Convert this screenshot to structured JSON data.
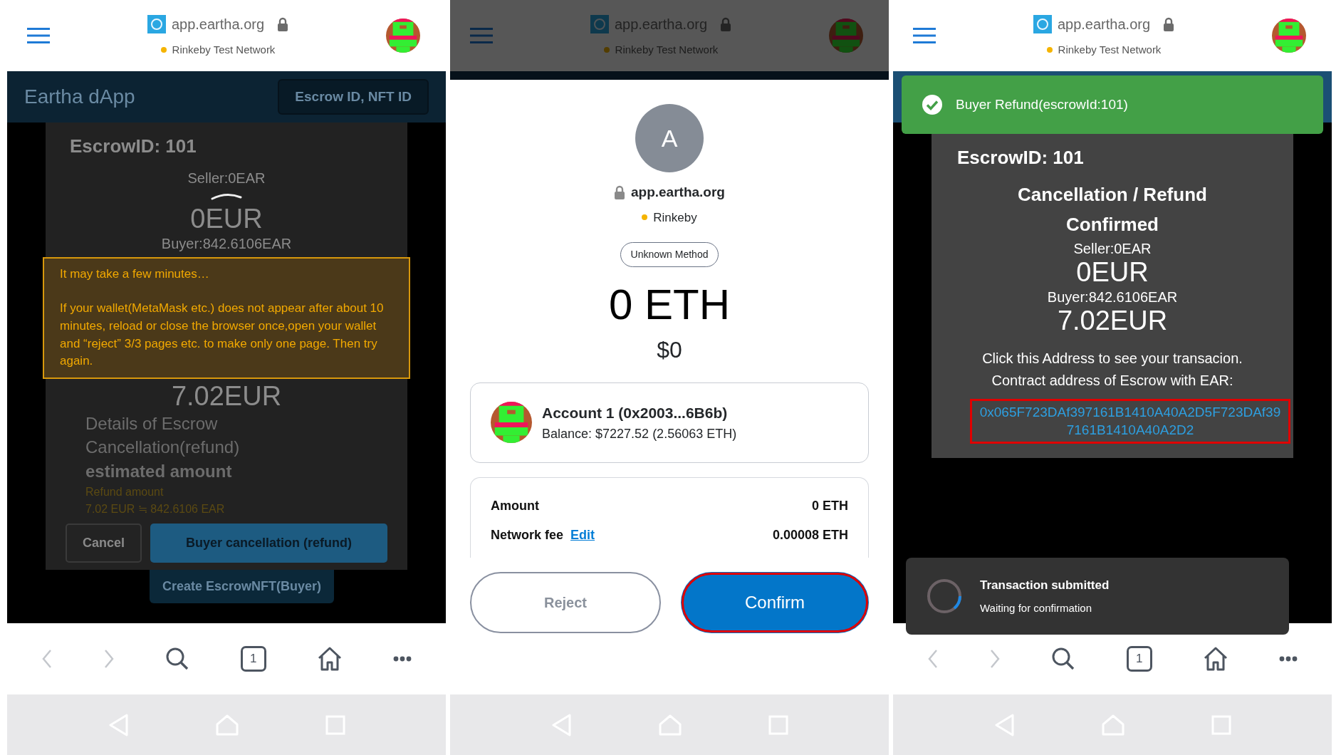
{
  "panels": [
    {
      "kind": "escrow_dialog",
      "topbar": {
        "url": "app.eartha.org",
        "network": "Rinkeby Test Network",
        "dimmed": false
      },
      "app": {
        "title": "Eartha dApp",
        "search_button": "Escrow ID, NFT ID"
      },
      "card": {
        "escrow_id": "EscrowID: 101",
        "seller": "Seller:0EAR",
        "seller_amount": "0EUR",
        "buyer": "Buyer:842.6106EAR",
        "warning": [
          "It may take a few minutes…",
          "If your wallet(MetaMask etc.) does not appear after about 10 minutes, reload or close the browser once,open your wallet and “reject” 3/3 pages etc. to make only one page. Then try again."
        ],
        "buyer_amount": "7.02EUR",
        "details": [
          "Details of Escrow",
          "Cancellation(refund)",
          "estimated amount"
        ],
        "refund_label": "Refund amount",
        "refund_value": "7.02 EUR ≒ 842.6106 EAR",
        "buttons": [
          {
            "label": "Cancel",
            "kind": "outline"
          },
          {
            "label": "Buyer cancellation (refund)",
            "kind": "primary"
          }
        ],
        "next_button": "Create EscrowNFT(Buyer)"
      },
      "toolbar": {
        "tab_count": "1"
      }
    },
    {
      "kind": "wallet_confirm",
      "topbar": {
        "url": "app.eartha.org",
        "network": "Rinkeby Test Network",
        "dimmed": true
      },
      "sheet": {
        "avatar_letter": "A",
        "host": "app.eartha.org",
        "network": "Rinkeby",
        "method": "Unknown Method",
        "amount": "0 ETH",
        "fiat": "$0",
        "account": {
          "name": "Account 1 (0x2003...6B6b)",
          "balance": "Balance: $7227.52 (2.56063 ETH)"
        },
        "rows": [
          {
            "label": "Amount",
            "value": "0 ETH"
          },
          {
            "label": "Network fee",
            "link": "Edit",
            "value": "0.00008 ETH"
          }
        ],
        "buttons": [
          {
            "label": "Reject",
            "kind": "secondary",
            "highlighted": false
          },
          {
            "label": "Confirm",
            "kind": "primary",
            "highlighted": true
          }
        ]
      }
    },
    {
      "kind": "refund_done",
      "topbar": {
        "url": "app.eartha.org",
        "network": "Rinkeby Test Network",
        "dimmed": false
      },
      "toast": "Buyer Refund(escrowId:101)",
      "card": {
        "escrow_id": "EscrowID: 101",
        "status": "Cancellation / Refund Confirmed",
        "seller": "Seller:0EAR",
        "seller_amount": "0EUR",
        "buyer": "Buyer:842.6106EAR",
        "buyer_amount": "7.02EUR",
        "notes": [
          "Click this Address to see your transacion.",
          "Contract address of Escrow with EAR:"
        ],
        "address": {
          "text": "0x065F723DAf397161B1410A40A2D5F723DAf397161B1410A40A2D2",
          "highlighted": true
        }
      },
      "tx_toast": {
        "title": "Transaction submitted",
        "subtitle": "Waiting for confirmation"
      },
      "toolbar": {
        "tab_count": "1"
      }
    }
  ]
}
